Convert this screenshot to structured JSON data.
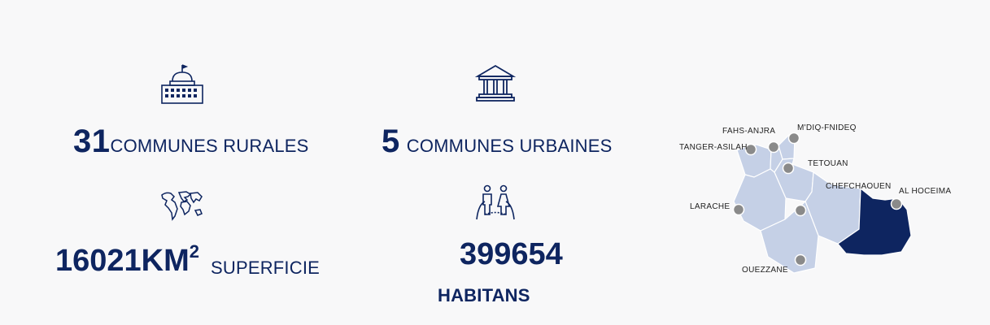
{
  "stats": {
    "rural": {
      "value": "31",
      "label": "COMMUNES RURALES",
      "icon": "parliament-building-icon"
    },
    "urban": {
      "value": "5",
      "label": "COMMUNES URBAINES",
      "icon": "classical-building-icon"
    },
    "area": {
      "value": "16021KM",
      "unit_sup": "2",
      "label": "SUPERFICIE",
      "icon": "world-map-icon"
    },
    "population": {
      "value": "399654",
      "label": "HABITANS",
      "icon": "people-globe-icon"
    }
  },
  "map": {
    "labels": [
      "FAHS-ANJRA",
      "M'DIQ-FNIDEQ",
      "TANGER-ASILAH",
      "TETOUAN",
      "CHEFCHAOUEN",
      "AL HOCEIMA",
      "LARACHE",
      "OUEZZANE"
    ],
    "highlighted": "AL HOCEIMA",
    "colors": {
      "region": "#c5d0e6",
      "highlight": "#0e2560",
      "marker": "#8a8a8a",
      "border": "#ffffff"
    }
  },
  "colors": {
    "text": "#0e2560",
    "background": "#f8f8f9"
  }
}
